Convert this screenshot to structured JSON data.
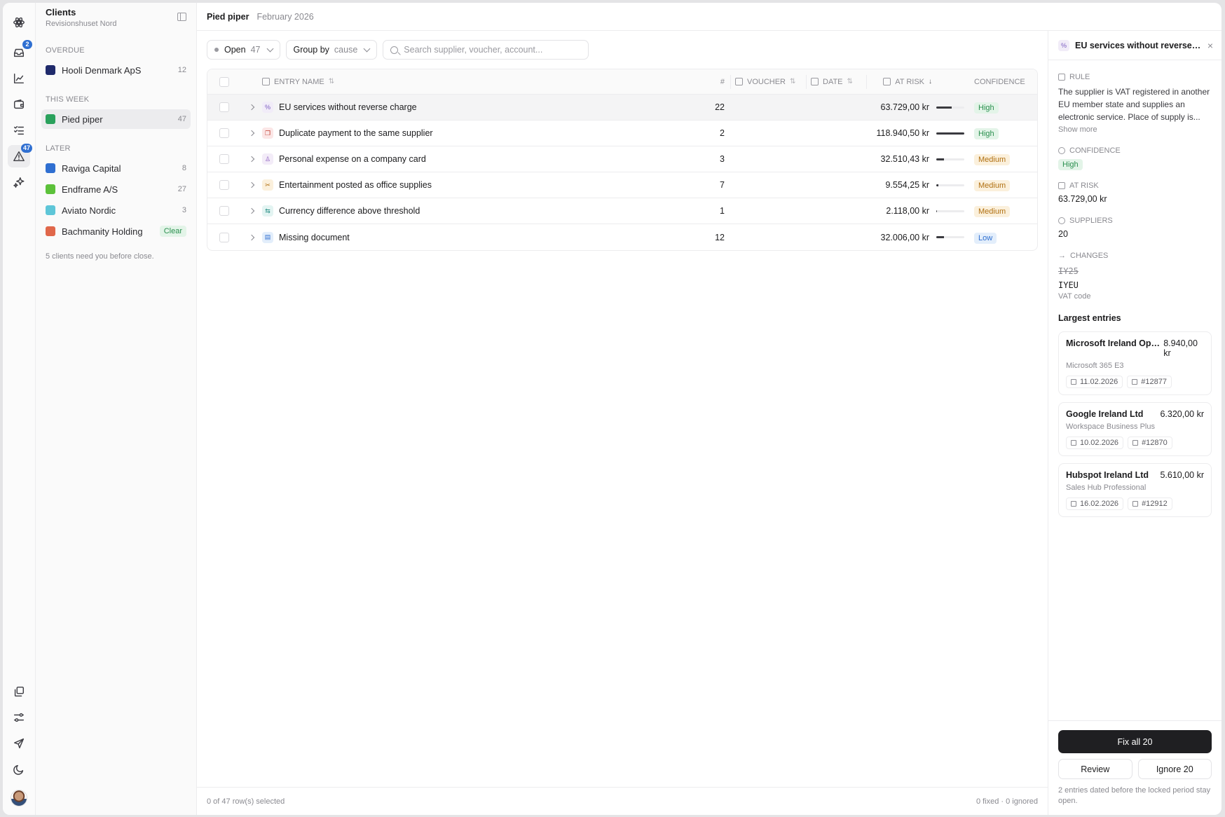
{
  "rail": {
    "inbox_badge": "2",
    "issues_badge": "47"
  },
  "clients": {
    "title": "Clients",
    "subtitle": "Revisionshuset Nord",
    "sections": {
      "overdue": "OVERDUE",
      "this_week": "THIS WEEK",
      "later": "LATER"
    },
    "overdue": [
      {
        "name": "Hooli Denmark ApS",
        "count": "12",
        "color": "#1f2a6b"
      }
    ],
    "this_week": [
      {
        "name": "Pied piper",
        "count": "47",
        "color": "#2aa15c"
      }
    ],
    "later": [
      {
        "name": "Raviga Capital",
        "count": "8",
        "color": "#2f6fd1"
      },
      {
        "name": "Endframe A/S",
        "count": "27",
        "color": "#5cc13a"
      },
      {
        "name": "Aviato Nordic",
        "count": "3",
        "color": "#5ec6d8"
      },
      {
        "name": "Bachmanity Holding",
        "clear_label": "Clear",
        "color": "#e0674a"
      }
    ],
    "note": "5 clients need you before close."
  },
  "topbar": {
    "client": "Pied piper",
    "period": "February 2026"
  },
  "toolbar": {
    "status_label": "Open",
    "status_count": "47",
    "group_label": "Group by",
    "group_value": "cause",
    "search_placeholder": "Search supplier, voucher, account..."
  },
  "table": {
    "headers": {
      "name": "ENTRY NAME",
      "count": "#",
      "voucher": "VOUCHER",
      "date": "DATE",
      "risk": "AT RISK",
      "confidence": "CONFIDENCE"
    },
    "rows": [
      {
        "name": "EU services without reverse charge",
        "count": "22",
        "risk": "63.729,00 kr",
        "risk_fraction": 0.54,
        "confidence": "High",
        "icon": "%",
        "icon_bg": "#f1ecf8",
        "icon_fg": "#7b5cc0"
      },
      {
        "name": "Duplicate payment to the same supplier",
        "count": "2",
        "risk": "118.940,50 kr",
        "risk_fraction": 1.0,
        "confidence": "High",
        "icon": "❐",
        "icon_bg": "#fbe6e6",
        "icon_fg": "#c0392b"
      },
      {
        "name": "Personal expense on a company card",
        "count": "3",
        "risk": "32.510,43 kr",
        "risk_fraction": 0.27,
        "confidence": "Medium",
        "icon": "♙",
        "icon_bg": "#f3ecf8",
        "icon_fg": "#8a5cc0"
      },
      {
        "name": "Entertainment posted as office supplies",
        "count": "7",
        "risk": "9.554,25 kr",
        "risk_fraction": 0.08,
        "confidence": "Medium",
        "icon": "✂",
        "icon_bg": "#fbf0dc",
        "icon_fg": "#b06f10"
      },
      {
        "name": "Currency difference above threshold",
        "count": "1",
        "risk": "2.118,00 kr",
        "risk_fraction": 0.03,
        "confidence": "Medium",
        "icon": "⇆",
        "icon_bg": "#e3f4f2",
        "icon_fg": "#2a8f86"
      },
      {
        "name": "Missing document",
        "count": "12",
        "risk": "32.006,00 kr",
        "risk_fraction": 0.27,
        "confidence": "Low",
        "icon": "▤",
        "icon_bg": "#e3eefb",
        "icon_fg": "#2f6fd1"
      }
    ]
  },
  "footer": {
    "selected": "0 of 47 row(s) selected",
    "status": "0 fixed · 0 ignored"
  },
  "detail": {
    "title": "EU services without reverse ch...",
    "rule_label": "RULE",
    "rule_text": "The supplier is VAT registered in another EU member state and supplies an electronic service. Place of supply is...",
    "show_more": "Show more",
    "confidence_label": "CONFIDENCE",
    "confidence_value": "High",
    "risk_label": "AT RISK",
    "risk_value": "63.729,00 kr",
    "suppliers_label": "SUPPLIERS",
    "suppliers_value": "20",
    "changes_label": "CHANGES",
    "changes_from": "IY25",
    "changes_to": "IYEU",
    "changes_note": "VAT code",
    "largest_title": "Largest entries",
    "entries": [
      {
        "name": "Microsoft Ireland Opera...",
        "amount": "8.940,00 kr",
        "desc": "Microsoft 365 E3",
        "date": "11.02.2026",
        "voucher": "#12877"
      },
      {
        "name": "Google Ireland Ltd",
        "amount": "6.320,00 kr",
        "desc": "Workspace Business Plus",
        "date": "10.02.2026",
        "voucher": "#12870"
      },
      {
        "name": "Hubspot Ireland Ltd",
        "amount": "5.610,00 kr",
        "desc": "Sales Hub Professional",
        "date": "16.02.2026",
        "voucher": "#12912"
      }
    ],
    "fix_label": "Fix all 20",
    "review_label": "Review",
    "ignore_label": "Ignore 20",
    "note": "2 entries dated before the locked period stay open."
  }
}
